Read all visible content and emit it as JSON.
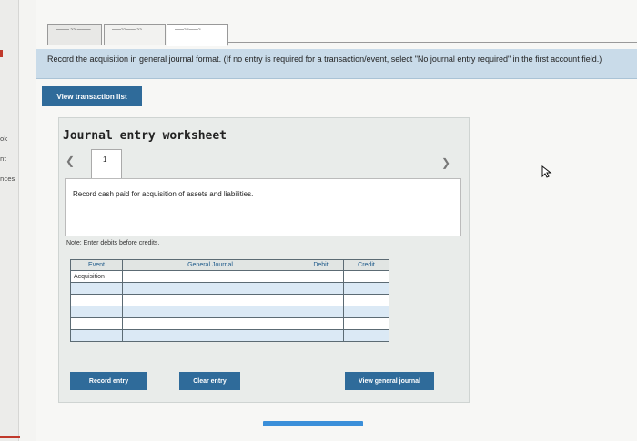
{
  "sidebar": {
    "fragments": [
      "ok",
      "nt",
      "nces"
    ]
  },
  "tabs": [
    {
      "label": "——— ~~ ———"
    },
    {
      "label": "——~~—— ~~"
    },
    {
      "label": "——~~——~"
    }
  ],
  "instruction": "Record the acquisition in general journal format. (If no entry is required for a transaction/event, select \"No journal entry required\" in the first account field.)",
  "buttons": {
    "view_transactions": "View transaction list",
    "record_entry": "Record entry",
    "clear_entry": "Clear entry",
    "view_general_journal": "View general journal"
  },
  "worksheet": {
    "title": "Journal entry worksheet",
    "page_number": "1",
    "description": "Record cash paid for acquisition of assets and liabilities.",
    "note": "Note: Enter debits before credits."
  },
  "table": {
    "headers": [
      "Event",
      "General Journal",
      "Debit",
      "Credit"
    ],
    "rows": [
      {
        "event": "Acquisition",
        "account": "",
        "debit": "",
        "credit": ""
      },
      {
        "event": "",
        "account": "",
        "debit": "",
        "credit": ""
      },
      {
        "event": "",
        "account": "",
        "debit": "",
        "credit": ""
      },
      {
        "event": "",
        "account": "",
        "debit": "",
        "credit": ""
      },
      {
        "event": "",
        "account": "",
        "debit": "",
        "credit": ""
      },
      {
        "event": "",
        "account": "",
        "debit": "",
        "credit": ""
      }
    ]
  },
  "progress": {
    "fraction": 1.0
  },
  "colors": {
    "accent": "#2f6b9a",
    "instruction_bg": "#c9dbe9",
    "progress": "#3b8fd9"
  }
}
